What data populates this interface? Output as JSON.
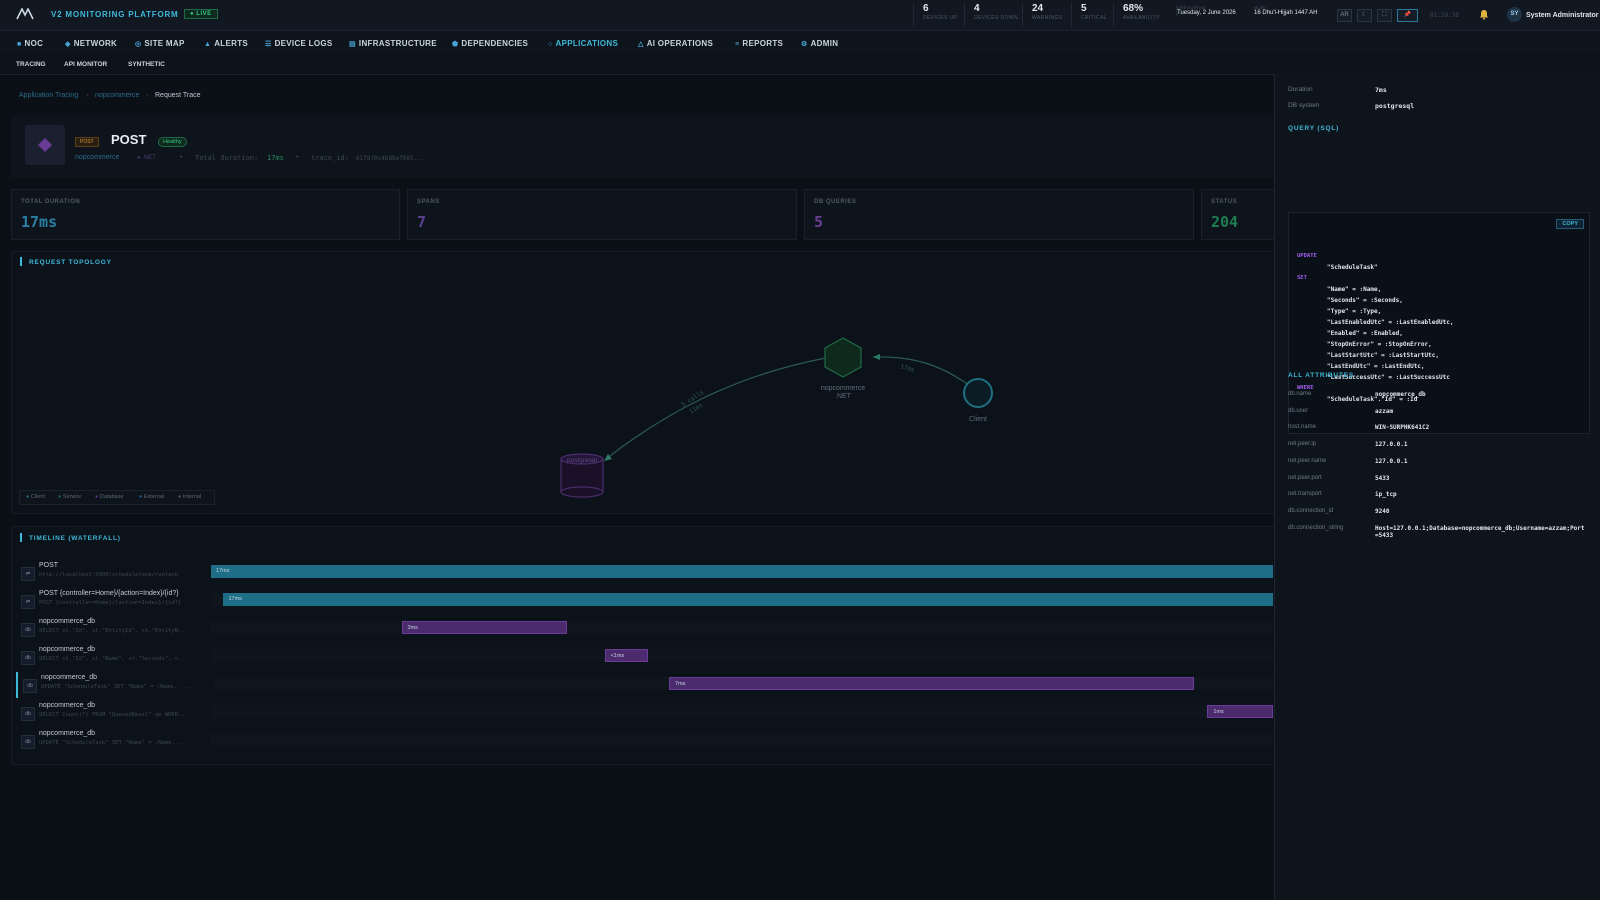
{
  "topbar": {
    "brand": "V2 MONITORING PLATFORM",
    "live": "● LIVE",
    "stats": [
      {
        "value": "6",
        "label": "DEVICES UP"
      },
      {
        "value": "4",
        "label": "DEVICES DOWN"
      },
      {
        "value": "24",
        "label": "WARNINGS"
      },
      {
        "value": "5",
        "label": "CRITICAL"
      },
      {
        "value": "68%",
        "label": "AVAILABILITY"
      }
    ],
    "gregorian_label": "GREGORIAN",
    "gregorian": "Tuesday, 2 June 2026",
    "hijri_label": "HIJRI",
    "hijri": "16 Dhu'l-Hijjah 1447 AH",
    "lang_btn": "AR",
    "clock": "01:29:38",
    "avatar": "SY",
    "user": "System Administrator"
  },
  "nav": {
    "items": [
      {
        "icon": "■",
        "label": "NOC"
      },
      {
        "icon": "◆",
        "label": "NETWORK"
      },
      {
        "icon": "◎",
        "label": "SITE MAP"
      },
      {
        "icon": "▲",
        "label": "ALERTS"
      },
      {
        "icon": "☰",
        "label": "DEVICE LOGS"
      },
      {
        "icon": "▤",
        "label": "INFRASTRUCTURE"
      },
      {
        "icon": "⬟",
        "label": "DEPENDENCIES"
      },
      {
        "icon": "○",
        "label": "APPLICATIONS"
      },
      {
        "icon": "△",
        "label": "AI OPERATIONS"
      },
      {
        "icon": "≡",
        "label": "REPORTS"
      },
      {
        "icon": "⚙",
        "label": "ADMIN"
      }
    ],
    "sub": [
      "TRACING",
      "API MONITOR",
      "SYNTHETIC"
    ]
  },
  "breadcrumb": {
    "c1": "Application Tracing",
    "c2": "nopcommerce",
    "c3": "Request Trace"
  },
  "trace": {
    "method_badge": "POST",
    "title": "POST",
    "status_badge": "Healthy",
    "service": "nopcommerce",
    "service_tag": "● .NET",
    "duration_label": "Total duration:",
    "duration": "17ms",
    "trace_label": "trace_id:",
    "trace_id": "61f870c4b8bef665..."
  },
  "metrics": [
    {
      "label": "TOTAL DURATION",
      "value": "17ms",
      "color": "#3fb8d8"
    },
    {
      "label": "SPANS",
      "value": "7",
      "color": "#8b5cf6"
    },
    {
      "label": "DB QUERIES",
      "value": "5",
      "color": "#a35cf0"
    },
    {
      "label": "STATUS",
      "value": "204",
      "color": "#2bb673"
    }
  ],
  "topology": {
    "title": "REQUEST TOPOLOGY",
    "nodes": {
      "service": "nopcommerce",
      "service_sub": ".NET",
      "client": "Client",
      "db": "postgresql"
    },
    "edges": {
      "client_to_service": "17ms",
      "service_to_db_line1": "5 calls",
      "service_to_db_line2": "11ms"
    },
    "legend": [
      "Client",
      "Service",
      "Database",
      "External",
      "Internal"
    ],
    "colors": {
      "client": "#2aa5b8",
      "service": "#2bb673",
      "database": "#a35cf0",
      "external": "#3b82f6",
      "internal": "#6b7785"
    }
  },
  "waterfall": {
    "title": "TIMELINE (WATERFALL)",
    "total_ms": 17,
    "rows": [
      {
        "icon": "⇄",
        "name": "POST",
        "sub": "http://localhost:5000/scheduletask/runtask",
        "label": "17ms",
        "start": 0,
        "duration": 17,
        "kind": "http"
      },
      {
        "icon": "⇄",
        "name": "POST {controller=Home}/{action=Index}/{id?}",
        "sub": "POST {controller=Home}/{action=Index}/{id?}",
        "label": "17ms",
        "start": 0.2,
        "duration": 16.8,
        "kind": "http"
      },
      {
        "icon": "db",
        "name": "nopcommerce_db",
        "sub": "SELECT st.\"Id\", st.\"EntityId\", st.\"EntityN...",
        "label": "3ms",
        "start": 3.05,
        "duration": 2.65,
        "kind": "db"
      },
      {
        "icon": "db",
        "name": "nopcommerce_db",
        "sub": "SELECT st.\"Id\", st.\"Name\", st.\"Seconds\", s...",
        "label": "<1ms",
        "start": 6.3,
        "duration": 0.7,
        "kind": "db"
      },
      {
        "icon": "db",
        "name": "nopcommerce_db",
        "sub": "UPDATE \"ScheduleTask\" SET \"Name\" = :Name, ...",
        "label": "7ms",
        "start": 7.3,
        "duration": 8.4,
        "kind": "db"
      },
      {
        "icon": "db",
        "name": "nopcommerce_db",
        "sub": "SELECT Count(*) FROM \"QueuedEmail\" qe WHER...",
        "label": "1ms",
        "start": 15.95,
        "duration": 1.05,
        "kind": "db"
      },
      {
        "icon": "db",
        "name": "nopcommerce_db",
        "sub": "UPDATE \"ScheduleTask\" SET \"Name\" = :Name, ...",
        "label": "",
        "start": 0,
        "duration": 0,
        "kind": "db"
      }
    ]
  },
  "panel": {
    "duration_key": "Duration",
    "duration_val": "7ms",
    "dbsys_key": "DB system",
    "dbsys_val": "postgresql",
    "query_title": "QUERY (SQL)",
    "copy": "COPY",
    "sql": [
      {
        "t": "UPDATE",
        "kw": true,
        "indent": 0
      },
      {
        "t": "\"ScheduleTask\"",
        "kw": false,
        "indent": 1
      },
      {
        "t": "SET",
        "kw": true,
        "indent": 0
      },
      {
        "t": "\"Name\" = :Name,",
        "kw": false,
        "indent": 1
      },
      {
        "t": "\"Seconds\" = :Seconds,",
        "kw": false,
        "indent": 1
      },
      {
        "t": "\"Type\" = :Type,",
        "kw": false,
        "indent": 1
      },
      {
        "t": "\"LastEnabledUtc\" = :LastEnabledUtc,",
        "kw": false,
        "indent": 1
      },
      {
        "t": "\"Enabled\" = :Enabled,",
        "kw": false,
        "indent": 1
      },
      {
        "t": "\"StopOnError\" = :StopOnError,",
        "kw": false,
        "indent": 1
      },
      {
        "t": "\"LastStartUtc\" = :LastStartUtc,",
        "kw": false,
        "indent": 1
      },
      {
        "t": "\"LastEndUtc\" = :LastEndUtc,",
        "kw": false,
        "indent": 1
      },
      {
        "t": "\"LastSuccessUtc\" = :LastSuccessUtc",
        "kw": false,
        "indent": 1
      },
      {
        "t": "WHERE",
        "kw": true,
        "indent": 0
      },
      {
        "t": "\"ScheduleTask\".\"Id\" = :Id",
        "kw": false,
        "indent": 1
      }
    ],
    "attr_title": "ALL ATTRIBUTES",
    "attrs": [
      {
        "k": "db.name",
        "v": "nopcommerce_db"
      },
      {
        "k": "db.user",
        "v": "azzam"
      },
      {
        "k": "host.name",
        "v": "WIN-SURPHK641C2"
      },
      {
        "k": "net.peer.ip",
        "v": "127.0.0.1"
      },
      {
        "k": "net.peer.name",
        "v": "127.0.0.1"
      },
      {
        "k": "net.peer.port",
        "v": "5433"
      },
      {
        "k": "net.transport",
        "v": "ip_tcp"
      },
      {
        "k": "db.connection_id",
        "v": "9240"
      },
      {
        "k": "db.connection_string",
        "v": "Host=127.0.0.1;Database=nopcommerce_db;Username=azzam;Port=5433"
      }
    ]
  }
}
